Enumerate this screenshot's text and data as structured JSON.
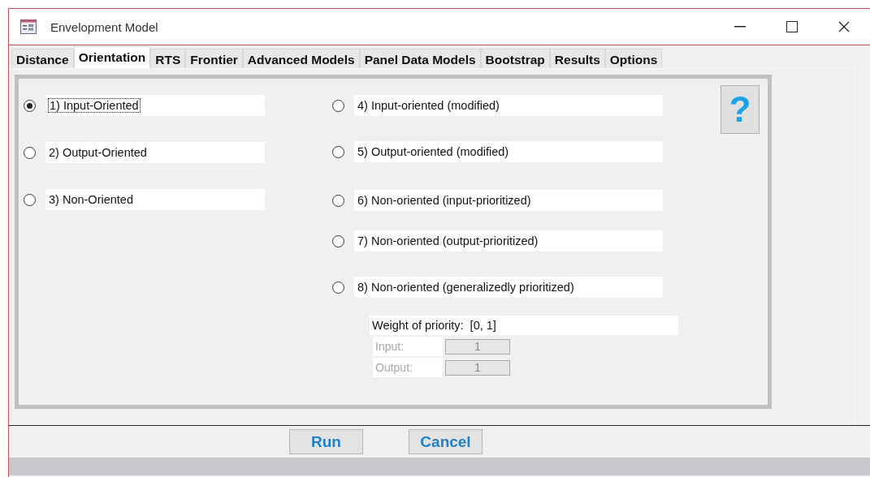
{
  "window": {
    "title": "Envelopment Model"
  },
  "tabs": [
    {
      "label": "Distance",
      "selected": false
    },
    {
      "label": "Orientation",
      "selected": true
    },
    {
      "label": "RTS",
      "selected": false
    },
    {
      "label": "Frontier",
      "selected": false
    },
    {
      "label": "Advanced Models",
      "selected": false
    },
    {
      "label": "Panel Data Models",
      "selected": false
    },
    {
      "label": "Bootstrap",
      "selected": false
    },
    {
      "label": "Results",
      "selected": false
    },
    {
      "label": "Options",
      "selected": false
    }
  ],
  "left_options": [
    {
      "label": "1) Input-Oriented",
      "selected": true,
      "focused": true
    },
    {
      "label": "2) Output-Oriented",
      "selected": false,
      "focused": false
    },
    {
      "label": "3) Non-Oriented",
      "selected": false,
      "focused": false
    }
  ],
  "right_options": [
    {
      "label": "4) Input-oriented (modified)",
      "selected": false
    },
    {
      "label": "5) Output-oriented (modified)",
      "selected": false
    },
    {
      "label": "6) Non-oriented (input-prioritized)",
      "selected": false
    },
    {
      "label": "7) Non-oriented (output-prioritized)",
      "selected": false
    },
    {
      "label": "8) Non-oriented (generalizedly prioritized)",
      "selected": false
    }
  ],
  "help_button": {
    "label": "?"
  },
  "weight": {
    "title": "Weight of priority:  [0, 1]",
    "disabled": true,
    "fields": [
      {
        "label": "Input:",
        "value": "1"
      },
      {
        "label": "Output:",
        "value": "1"
      }
    ]
  },
  "buttons": [
    "Run",
    "Cancel"
  ]
}
